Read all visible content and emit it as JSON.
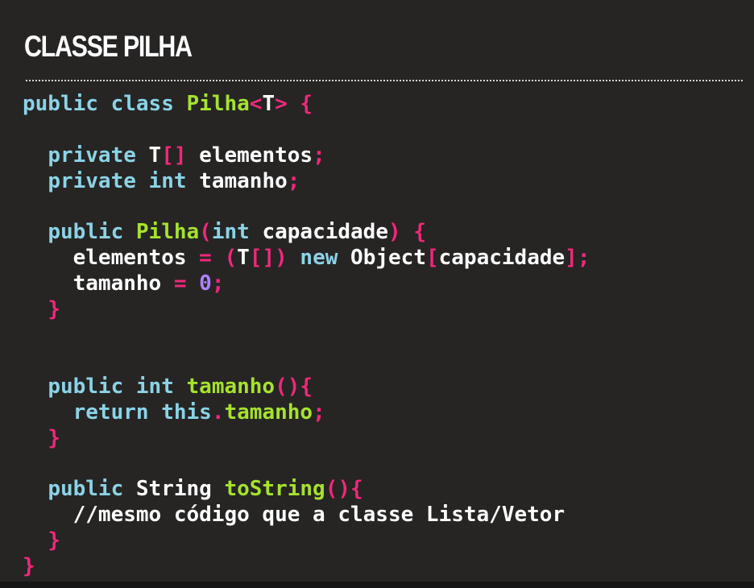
{
  "slide": {
    "title": "CLASSE PILHA"
  },
  "colors": {
    "background": "#262524",
    "keyword": "#8bd3e6",
    "class_name": "#a6e22e",
    "method_name": "#a6e22e",
    "punctuation": "#f0287a",
    "number": "#ae81ff",
    "text": "#ffffff"
  },
  "code": {
    "language": "java",
    "lines": [
      [
        {
          "t": "public",
          "k": "kw"
        },
        {
          "t": " "
        },
        {
          "t": "class",
          "k": "kw"
        },
        {
          "t": " "
        },
        {
          "t": "Pilha",
          "k": "cls"
        },
        {
          "t": "<",
          "k": "pun"
        },
        {
          "t": "T",
          "k": "var"
        },
        {
          "t": ">",
          "k": "pun"
        },
        {
          "t": " "
        },
        {
          "t": "{",
          "k": "pun"
        }
      ],
      [],
      [
        {
          "t": "  "
        },
        {
          "t": "private",
          "k": "kw"
        },
        {
          "t": " "
        },
        {
          "t": "T",
          "k": "var"
        },
        {
          "t": "[]",
          "k": "pun"
        },
        {
          "t": " "
        },
        {
          "t": "elementos",
          "k": "var"
        },
        {
          "t": ";",
          "k": "pun"
        }
      ],
      [
        {
          "t": "  "
        },
        {
          "t": "private",
          "k": "kw"
        },
        {
          "t": " "
        },
        {
          "t": "int",
          "k": "kw"
        },
        {
          "t": " "
        },
        {
          "t": "tamanho",
          "k": "var"
        },
        {
          "t": ";",
          "k": "pun"
        }
      ],
      [],
      [
        {
          "t": "  "
        },
        {
          "t": "public",
          "k": "kw"
        },
        {
          "t": " "
        },
        {
          "t": "Pilha",
          "k": "fn"
        },
        {
          "t": "(",
          "k": "pun"
        },
        {
          "t": "int",
          "k": "kw"
        },
        {
          "t": " "
        },
        {
          "t": "capacidade",
          "k": "var"
        },
        {
          "t": ")",
          "k": "pun"
        },
        {
          "t": " "
        },
        {
          "t": "{",
          "k": "pun"
        }
      ],
      [
        {
          "t": "    "
        },
        {
          "t": "elementos",
          "k": "var"
        },
        {
          "t": " "
        },
        {
          "t": "=",
          "k": "op"
        },
        {
          "t": " "
        },
        {
          "t": "(",
          "k": "pun"
        },
        {
          "t": "T",
          "k": "var"
        },
        {
          "t": "[])",
          "k": "pun"
        },
        {
          "t": " "
        },
        {
          "t": "new",
          "k": "kw"
        },
        {
          "t": " "
        },
        {
          "t": "Object",
          "k": "var"
        },
        {
          "t": "[",
          "k": "pun"
        },
        {
          "t": "capacidade",
          "k": "var"
        },
        {
          "t": "];",
          "k": "pun"
        }
      ],
      [
        {
          "t": "    "
        },
        {
          "t": "tamanho",
          "k": "var"
        },
        {
          "t": " "
        },
        {
          "t": "=",
          "k": "op"
        },
        {
          "t": " "
        },
        {
          "t": "0",
          "k": "num"
        },
        {
          "t": ";",
          "k": "pun"
        }
      ],
      [
        {
          "t": "  "
        },
        {
          "t": "}",
          "k": "pun"
        }
      ],
      [],
      [],
      [
        {
          "t": "  "
        },
        {
          "t": "public",
          "k": "kw"
        },
        {
          "t": " "
        },
        {
          "t": "int",
          "k": "kw"
        },
        {
          "t": " "
        },
        {
          "t": "tamanho",
          "k": "fn"
        },
        {
          "t": "(){",
          "k": "pun"
        }
      ],
      [
        {
          "t": "    "
        },
        {
          "t": "return",
          "k": "kw"
        },
        {
          "t": " "
        },
        {
          "t": "this",
          "k": "kw"
        },
        {
          "t": ".",
          "k": "pun"
        },
        {
          "t": "tamanho",
          "k": "fn"
        },
        {
          "t": ";",
          "k": "pun"
        }
      ],
      [
        {
          "t": "  "
        },
        {
          "t": "}",
          "k": "pun"
        }
      ],
      [],
      [
        {
          "t": "  "
        },
        {
          "t": "public",
          "k": "kw"
        },
        {
          "t": " "
        },
        {
          "t": "String",
          "k": "var"
        },
        {
          "t": " "
        },
        {
          "t": "toString",
          "k": "fn"
        },
        {
          "t": "(){",
          "k": "pun"
        }
      ],
      [
        {
          "t": "    "
        },
        {
          "t": "//mesmo código que a classe Lista/Vetor",
          "k": "cm"
        }
      ],
      [
        {
          "t": "  "
        },
        {
          "t": "}",
          "k": "pun"
        }
      ],
      [
        {
          "t": "}",
          "k": "pun"
        }
      ]
    ]
  }
}
